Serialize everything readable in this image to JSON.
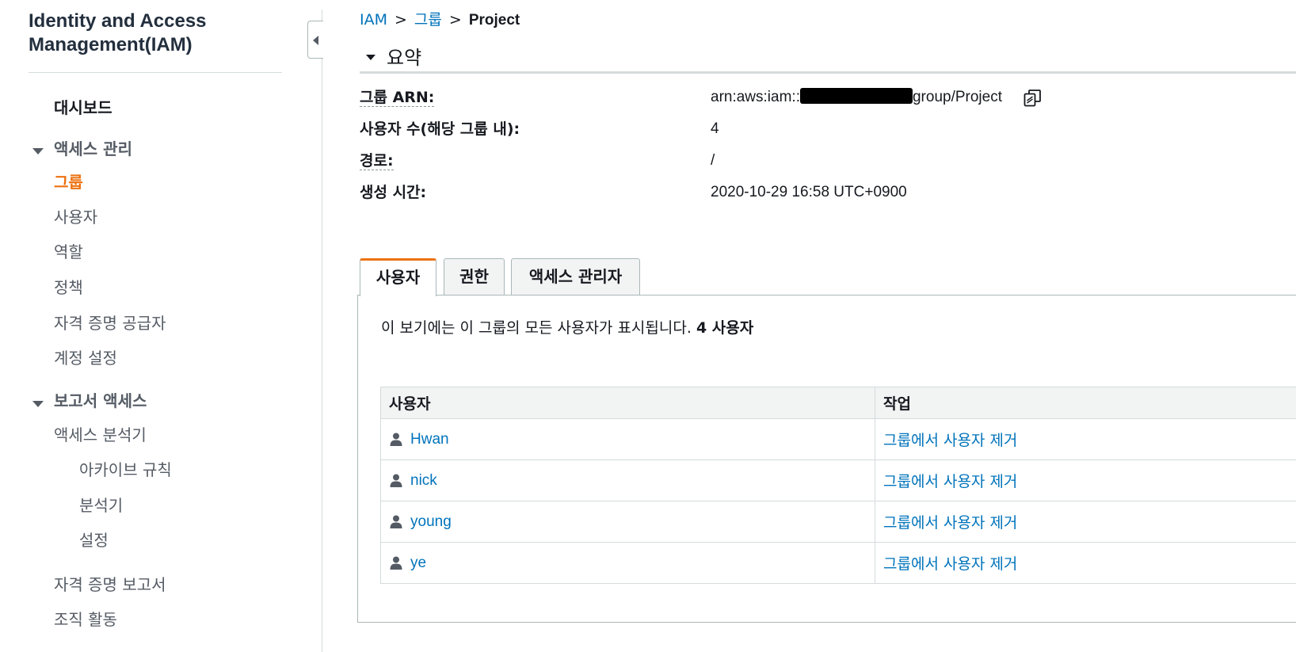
{
  "sidebar": {
    "title": "Identity and Access Management(IAM)",
    "dashboard": "대시보드",
    "access_management": {
      "label": "액세스 관리",
      "items": [
        "그룹",
        "사용자",
        "역할",
        "정책",
        "자격 증명 공급자",
        "계정 설정"
      ]
    },
    "access_reports": {
      "label": "보고서 액세스",
      "analyzer": "액세스 분석기",
      "sub_items": [
        "아카이브 규칙",
        "분석기",
        "설정"
      ],
      "credential_report": "자격 증명 보고서",
      "org_activity": "조직 활동"
    }
  },
  "breadcrumb": {
    "root": "IAM",
    "sep": ">",
    "groups": "그룹",
    "current": "Project"
  },
  "summary": {
    "header": "요약",
    "arn_label": "그룹 ARN:",
    "arn_prefix": "arn:aws:iam::",
    "arn_suffix": "group/Project",
    "user_count_label": "사용자 수(해당 그룹 내):",
    "user_count": "4",
    "path_label": "경로:",
    "path": "/",
    "created_label": "생성 시간:",
    "created": "2020-10-29 16:58 UTC+0900"
  },
  "tabs": [
    "사용자",
    "권한",
    "액세스 관리자"
  ],
  "users_panel": {
    "description": "이 보기에는 이 그룹의 모든 사용자가 표시됩니다.",
    "count_text": "4 사용자",
    "columns": [
      "사용자",
      "작업"
    ],
    "rows": [
      {
        "user": "Hwan",
        "action": "그룹에서 사용자 제거"
      },
      {
        "user": "nick",
        "action": "그룹에서 사용자 제거"
      },
      {
        "user": "young",
        "action": "그룹에서 사용자 제거"
      },
      {
        "user": "ye",
        "action": "그룹에서 사용자 제거"
      }
    ]
  },
  "colors": {
    "active": "#ec7211",
    "link": "#0073bb",
    "text": "#16191f",
    "muted": "#545b64"
  }
}
